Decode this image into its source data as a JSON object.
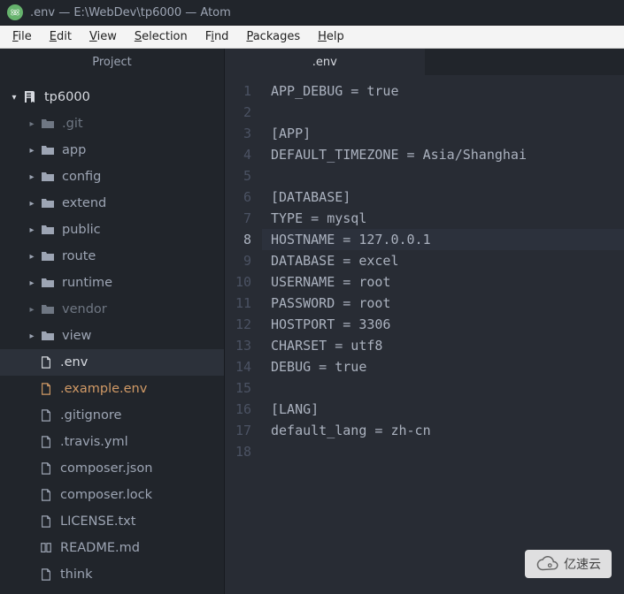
{
  "title": ".env — E:\\WebDev\\tp6000 — Atom",
  "menu": {
    "file": "File",
    "edit": "Edit",
    "view": "View",
    "selection": "Selection",
    "find": "Find",
    "packages": "Packages",
    "help": "Help"
  },
  "project_label": "Project",
  "active_tab": ".env",
  "root_name": "tp6000",
  "folders": {
    "git": ".git",
    "app": "app",
    "config": "config",
    "extend": "extend",
    "public": "public",
    "route": "route",
    "runtime": "runtime",
    "vendor": "vendor",
    "view": "view"
  },
  "files": {
    "env": ".env",
    "example_env": ".example.env",
    "gitignore": ".gitignore",
    "travis": ".travis.yml",
    "composer_json": "composer.json",
    "composer_lock": "composer.lock",
    "license": "LICENSE.txt",
    "readme": "README.md",
    "think": "think"
  },
  "code_lines": [
    "APP_DEBUG = true",
    "",
    "[APP]",
    "DEFAULT_TIMEZONE = Asia/Shanghai",
    "",
    "[DATABASE]",
    "TYPE = mysql",
    "HOSTNAME = 127.0.0.1",
    "DATABASE = excel",
    "USERNAME = root",
    "PASSWORD = root",
    "HOSTPORT = 3306",
    "CHARSET = utf8",
    "DEBUG = true",
    "",
    "[LANG]",
    "default_lang = zh-cn",
    ""
  ],
  "highlighted_line": 8,
  "watermark": "亿速云"
}
